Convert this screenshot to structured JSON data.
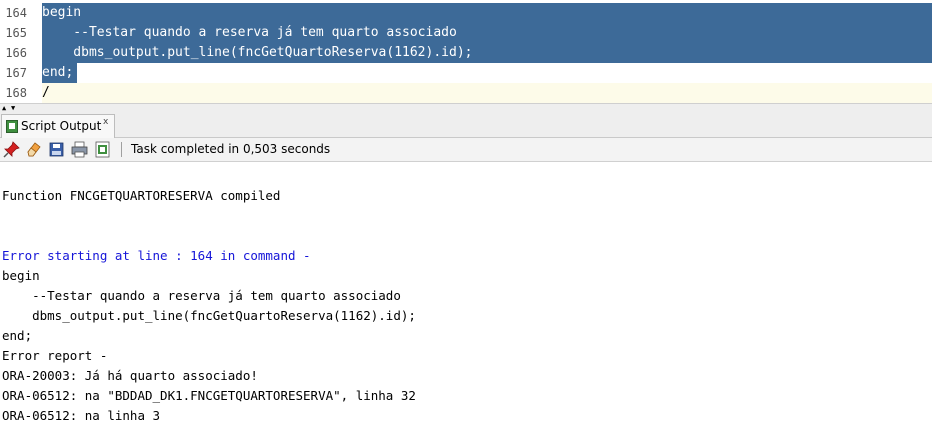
{
  "editor": {
    "line_numbers": [
      "164",
      "165",
      "166",
      "167",
      "168"
    ],
    "lines": [
      "begin",
      "    --Testar quando a reserva já tem quarto associado",
      "    dbms_output.put_line(fncGetQuartoReserva(1162).id);",
      "end;",
      "/"
    ]
  },
  "splitter": {
    "up_arrow": "▲",
    "down_arrow": "▼"
  },
  "tab": {
    "label": "Script Output",
    "close": "x"
  },
  "toolbar": {
    "icons": [
      "pin-icon",
      "eraser-icon",
      "save-icon",
      "print-icon",
      "open-file-icon"
    ],
    "status": "Task completed in 0,503 seconds"
  },
  "output": {
    "compiled": "Function FNCGETQUARTORESERVA compiled",
    "error_header": "Error starting at line : 164 in command -",
    "echo": [
      "begin",
      "    --Testar quando a reserva já tem quarto associado",
      "    dbms_output.put_line(fncGetQuartoReserva(1162).id);",
      "end;"
    ],
    "report": [
      "Error report -",
      "ORA-20003: Já há quarto associado!",
      "ORA-06512: na \"BDDAD_DK1.FNCGETQUARTORESERVA\", linha 32",
      "ORA-06512: na linha 3"
    ]
  },
  "colors": {
    "selection": "#3d6a98",
    "error_header": "#1515d8",
    "current_line": "#fdfbe9"
  }
}
